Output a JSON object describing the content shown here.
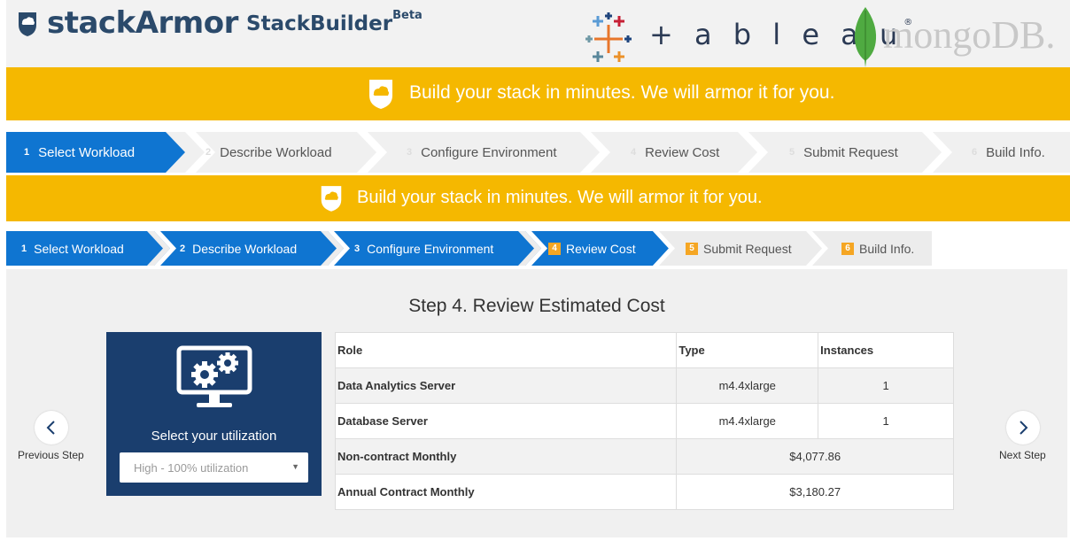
{
  "header": {
    "brand": "stackArmor",
    "product": "StackBuilder",
    "product_tag": "Beta",
    "partner1": "+ a b l e a u",
    "partner1_tm": "®",
    "partner2": "mongoDB."
  },
  "banner": {
    "tagline": "Build your stack in minutes. We will armor it for you."
  },
  "wizard_top": {
    "steps": [
      {
        "num": "1",
        "label": "Select Workload"
      },
      {
        "num": "2",
        "label": "Describe Workload"
      },
      {
        "num": "3",
        "label": "Configure Environment"
      },
      {
        "num": "4",
        "label": "Review Cost"
      },
      {
        "num": "5",
        "label": "Submit Request"
      },
      {
        "num": "6",
        "label": "Build Info."
      }
    ]
  },
  "wizard": {
    "steps": [
      {
        "num": "1",
        "label": "Select Workload"
      },
      {
        "num": "2",
        "label": "Describe Workload"
      },
      {
        "num": "3",
        "label": "Configure Environment"
      },
      {
        "num": "4",
        "label": "Review Cost"
      },
      {
        "num": "5",
        "label": "Submit Request"
      },
      {
        "num": "6",
        "label": "Build Info."
      }
    ]
  },
  "main": {
    "title": "Step 4. Review Estimated Cost",
    "prev_label": "Previous Step",
    "next_label": "Next Step",
    "utilization": {
      "label": "Select your utilization",
      "selected": "High - 100% utilization"
    },
    "table": {
      "headers": [
        "Role",
        "Type",
        "Instances"
      ],
      "rows": [
        {
          "role": "Data Analytics Server",
          "type": "m4.4xlarge",
          "instances": "1"
        },
        {
          "role": "Database Server",
          "type": "m4.4xlarge",
          "instances": "1"
        }
      ],
      "totals": [
        {
          "label": "Non-contract Monthly",
          "value": "$4,077.86"
        },
        {
          "label": "Annual Contract Monthly",
          "value": "$3,180.27"
        }
      ]
    }
  },
  "colors": {
    "accent_blue": "#0f75d1",
    "banner_yellow": "#f5b800",
    "panel_navy": "#1a3e6e"
  }
}
